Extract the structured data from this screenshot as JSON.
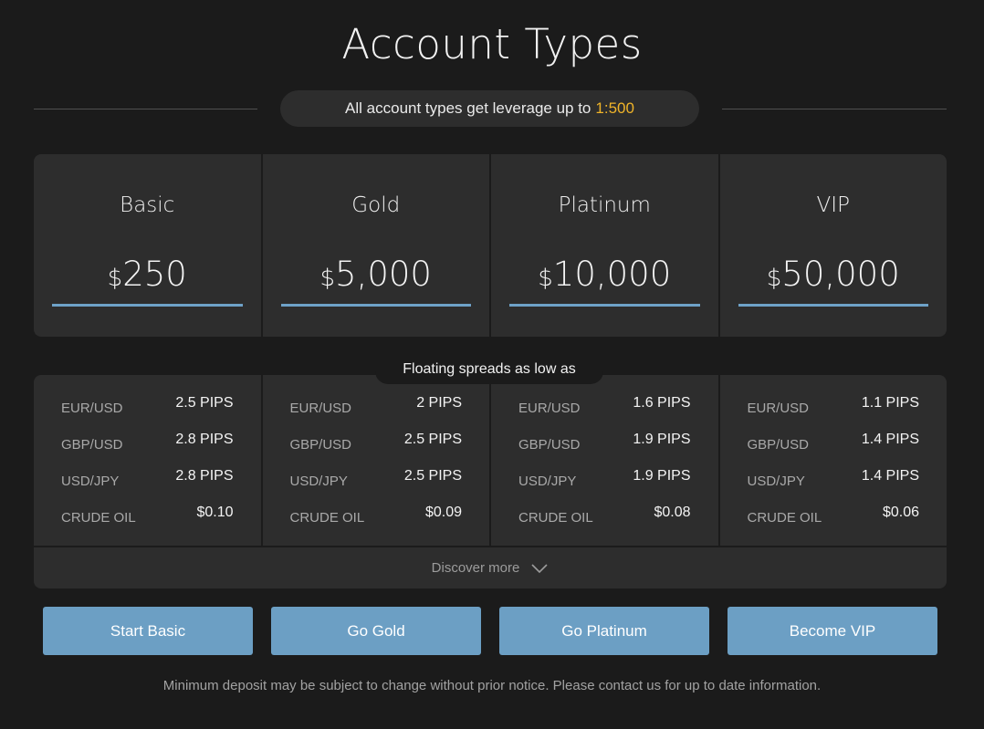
{
  "title": "Account Types",
  "leverage": {
    "text": "All account types get leverage up to",
    "ratio": "1:500"
  },
  "tiers": [
    {
      "name": "Basic",
      "currency": "$",
      "amount": "250"
    },
    {
      "name": "Gold",
      "currency": "$",
      "amount": "5,000"
    },
    {
      "name": "Platinum",
      "currency": "$",
      "amount": "10,000"
    },
    {
      "name": "VIP",
      "currency": "$",
      "amount": "50,000"
    }
  ],
  "spreads": {
    "label": "Floating spreads as low as",
    "columns": [
      {
        "rows": [
          {
            "pair": "EUR/USD",
            "value": "2.5 PIPS"
          },
          {
            "pair": "GBP/USD",
            "value": "2.8 PIPS"
          },
          {
            "pair": "USD/JPY",
            "value": "2.8 PIPS"
          },
          {
            "pair": "CRUDE OIL",
            "value": "$0.10"
          }
        ]
      },
      {
        "rows": [
          {
            "pair": "EUR/USD",
            "value": "2 PIPS"
          },
          {
            "pair": "GBP/USD",
            "value": "2.5 PIPS"
          },
          {
            "pair": "USD/JPY",
            "value": "2.5 PIPS"
          },
          {
            "pair": "CRUDE OIL",
            "value": "$0.09"
          }
        ]
      },
      {
        "rows": [
          {
            "pair": "EUR/USD",
            "value": "1.6 PIPS"
          },
          {
            "pair": "GBP/USD",
            "value": "1.9 PIPS"
          },
          {
            "pair": "USD/JPY",
            "value": "1.9 PIPS"
          },
          {
            "pair": "CRUDE OIL",
            "value": "$0.08"
          }
        ]
      },
      {
        "rows": [
          {
            "pair": "EUR/USD",
            "value": "1.1 PIPS"
          },
          {
            "pair": "GBP/USD",
            "value": "1.4 PIPS"
          },
          {
            "pair": "USD/JPY",
            "value": "1.4 PIPS"
          },
          {
            "pair": "CRUDE OIL",
            "value": "$0.06"
          }
        ]
      }
    ]
  },
  "discover": {
    "label": "Discover more",
    "icon": "chevron-down-icon"
  },
  "buttons": [
    "Start Basic",
    "Go Gold",
    "Go Platinum",
    "Become VIP"
  ],
  "disclaimer": "Minimum deposit may be subject to change without prior notice. Please contact us for up to date information.",
  "colors": {
    "accent": "#6c9fc4",
    "highlight": "#f0b429",
    "panel": "#2d2d2d",
    "background": "#1b1b1b"
  }
}
